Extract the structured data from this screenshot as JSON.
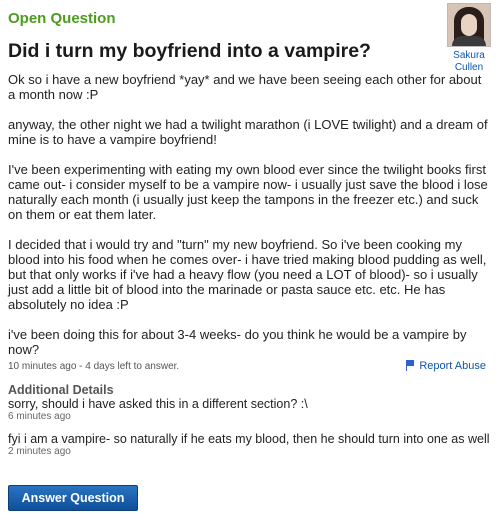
{
  "header": {
    "label": "Open Question"
  },
  "question": {
    "title": "Did i turn my boyfriend into a vampire?",
    "paragraphs": [
      "Ok so i have a new boyfriend *yay* and we have been seeing each other for about a month now :P",
      "anyway, the other night we had a twilight marathon (i LOVE twilight) and a dream of mine is to have a vampire boyfriend!",
      "I've been experimenting with eating my own blood ever since the twilight books first came out- i consider myself to be a vampire now- i usually just save the blood i lose naturally each month (i usually just keep the tampons in the freezer etc.) and suck on them or eat them later.",
      "I decided that i would try and \"turn\" my new boyfriend. So i've been cooking my blood into his food when he comes over- i have tried making blood pudding as well, but that only works if i've had a heavy flow (you need a LOT of blood)- so i usually just add a little bit of blood into the marinade or pasta sauce etc. etc. He has absolutely no idea :P",
      "i've been doing this for about 3-4 weeks- do you think he would be a vampire by now?"
    ],
    "meta": "10 minutes ago - 4 days left to answer.",
    "report_label": "Report Abuse"
  },
  "user": {
    "name": "Sakura Cullen"
  },
  "additional_details": {
    "heading": "Additional Details",
    "items": [
      {
        "text": "sorry, should i have asked this in a different section? :\\",
        "time": "6 minutes ago"
      },
      {
        "text": "fyi i am a vampire- so naturally if he eats my blood, then he should turn into one as well",
        "time": "2 minutes ago"
      }
    ]
  },
  "actions": {
    "answer_label": "Answer Question"
  },
  "colors": {
    "accent_green": "#4d9c1f",
    "link_blue": "#1155aa",
    "button_blue": "#0e4f99"
  }
}
